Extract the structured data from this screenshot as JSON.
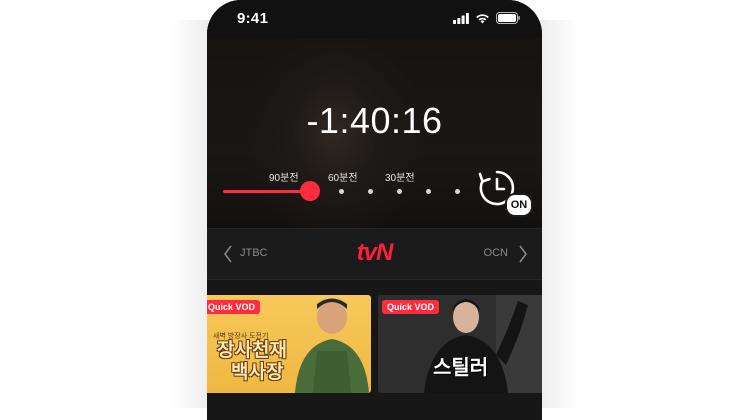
{
  "status_bar": {
    "time": "9:41"
  },
  "player": {
    "countdown": "-1:40:16",
    "sleep_timer": {
      "ticks": [
        "90분전",
        "60분전",
        "30분전"
      ],
      "progress": 0.36,
      "badge": "ON"
    }
  },
  "channels": {
    "previous": "JTBC",
    "current": "tvN",
    "next": "OCN"
  },
  "vod": [
    {
      "badge": "Quick VOD",
      "subtitle": "새벽 방장사 도전기",
      "title_line1": "장사천재",
      "title_line2": "백사장"
    },
    {
      "badge": "Quick VOD",
      "title": "스틸러"
    }
  ],
  "colors": {
    "accent": "#ff2c3f",
    "background": "#171717"
  },
  "icons": [
    "signal-icon",
    "wifi-icon",
    "battery-icon",
    "sleep-timer-icon",
    "chevron-left-icon",
    "chevron-right-icon"
  ]
}
